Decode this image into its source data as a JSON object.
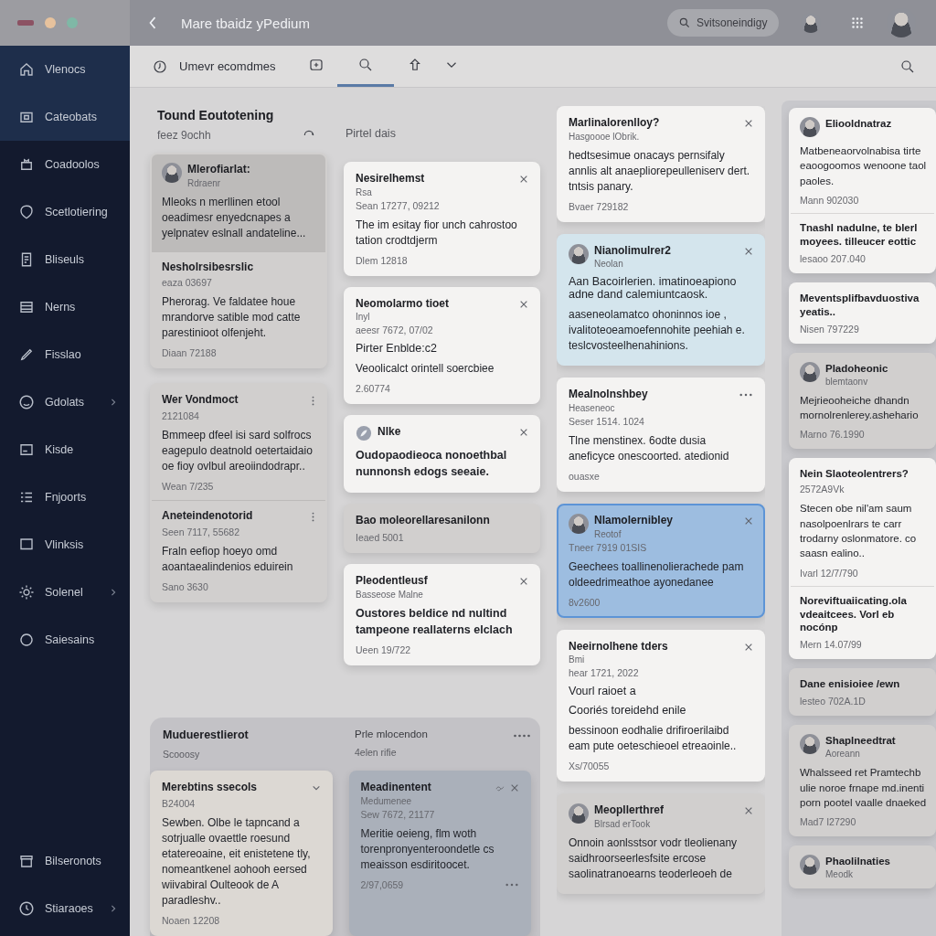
{
  "window": {
    "title": "Mare tbaidz yPedium"
  },
  "top_search": {
    "placeholder": "Svitsoneindigy"
  },
  "sidebar": {
    "items": [
      {
        "label": "Vlenocs",
        "selected": true,
        "expandable": false
      },
      {
        "label": "Cateobats",
        "selected": true,
        "expandable": false
      },
      {
        "label": "Coadoolos",
        "selected": false,
        "expandable": false
      },
      {
        "label": "Scetlotiering",
        "selected": false,
        "expandable": false
      },
      {
        "label": "Bliseuls",
        "selected": false,
        "expandable": false
      },
      {
        "label": "Nerns",
        "selected": false,
        "expandable": false
      },
      {
        "label": "Fisslao",
        "selected": false,
        "expandable": false
      },
      {
        "label": "Gdolats",
        "selected": false,
        "expandable": true
      },
      {
        "label": "Kisde",
        "selected": false,
        "expandable": false
      },
      {
        "label": "Fnjoorts",
        "selected": false,
        "expandable": false
      },
      {
        "label": "Vlinksis",
        "selected": false,
        "expandable": false
      },
      {
        "label": "Solenel",
        "selected": false,
        "expandable": true
      },
      {
        "label": "Saiesains",
        "selected": false,
        "expandable": false
      }
    ],
    "footer_items": [
      {
        "label": "Bilseronots",
        "selected": false,
        "expandable": false
      },
      {
        "label": "Stiaraoes",
        "selected": false,
        "expandable": true
      }
    ]
  },
  "toolbar": {
    "label": "Umevr ecomdmes",
    "tabs": [
      {
        "selected": false
      },
      {
        "selected": true
      },
      {
        "selected": false
      },
      {
        "selected": false
      }
    ]
  },
  "section": {
    "title": "Tound Eoutotening",
    "subtitle": "feez 9ochh",
    "filter": "Pirtel dais"
  },
  "columns": [
    {
      "kind": "stack",
      "cards": [
        {
          "kind": "muted",
          "selected": false,
          "entries": [
            {
              "title": "Mlerofiarlat:",
              "subtitle": "Rdraenr",
              "avatar": true,
              "highlighted": true,
              "body": "Mleoks n merllinen etool oeadimesr enyedcnapes a yelpnatev eslnall andateline..."
            },
            {
              "title": "Nesholrsibesrslic",
              "meta": "eaza 03697",
              "body": "Pherorag. Ve faldatee houe mrandorve satible mod catte parestinioot olfenjeht.",
              "footer": "Diaan 72188"
            }
          ]
        },
        {
          "kind": "muted",
          "selected": false,
          "entries": [
            {
              "title": "Wer Vondmoct",
              "meta": "2121084",
              "options": true,
              "body": "Bmmeep dfeel isi sard solfrocs eagepulo deatnold oetertaidaio oe fioy ovlbul areoiindodrapr..",
              "footer": "Wean 7/235"
            },
            {
              "title": "Aneteindenotorid",
              "meta": "Seen 7117, 55682",
              "options": true,
              "body": "Fraln eefiop hoeyo omd aoantaealindenios eduirein",
              "footer": "Sano 3630"
            }
          ]
        }
      ]
    },
    {
      "kind": "stack",
      "cards": [
        {
          "kind": "plain",
          "selected": false,
          "entries": [
            {
              "title": "Nesirelhemst",
              "subtitle": "Rsa",
              "meta": "Sean 17277, 09212",
              "closable": true,
              "body": "The im esitay fior unch cahrostoo tation crodtdjerm",
              "footer": "Dlem 12818"
            }
          ]
        },
        {
          "kind": "plain",
          "selected": false,
          "entries": [
            {
              "title": "Neomolarmo tioet",
              "subtitle": "Inyl",
              "meta": "aeesr 7672, 07/02",
              "closable": true,
              "lead": [
                "Pirter Enblde:c2"
              ],
              "body": "Veoolicalct orintell soercbiee",
              "footer": "2.60774"
            }
          ]
        },
        {
          "kind": "plain",
          "selected": false,
          "entries": [
            {
              "title": "Nlke",
              "logo": true,
              "closable": true,
              "strong": true,
              "body": "Oudopaodieoca nonoethbal nunnonsh edogs seeaie."
            }
          ]
        },
        {
          "kind": "muted",
          "selected": false,
          "entries": [
            {
              "title": "Bao moleorellaresanilonn",
              "footer": "Ieaed 5001"
            }
          ]
        },
        {
          "kind": "plain",
          "selected": false,
          "entries": [
            {
              "title": "Pleodentleusf",
              "subtitle": "Basseose Malne",
              "closable": true,
              "strong": true,
              "body": "Oustores beldice nd nultind tampeone reallaterns elclach",
              "footer": "Ueen 19/722"
            }
          ]
        }
      ]
    },
    {
      "kind": "stack",
      "cards": [
        {
          "kind": "plain",
          "selected": false,
          "entries": [
            {
              "title": "Marlinalorenlloy?",
              "subtitle": "Hasgoooe lObrik.",
              "closable": true,
              "body": "hedtsesimue onacays pernsifaly annlis alt anaepliorepeulleniserv dert. tntsis panary.",
              "footer": "Bvaer 729182"
            }
          ]
        },
        {
          "kind": "info",
          "selected": false,
          "entries": [
            {
              "title": "Nianolimulrer2",
              "subtitle": "Neolan",
              "avatar": true,
              "closable": true,
              "lead": [
                "Aan Bacoirlerien. imatinoeapiono adne dand calemiuntcaosk."
              ],
              "body": "aaseneolamatco ohoninnos ioe , ivalitoteoeamoefennohite peehiah e. teslcvosteelhenahinions."
            }
          ]
        },
        {
          "kind": "plain",
          "selected": false,
          "entries": [
            {
              "title": "Mealnolnshbey",
              "subtitle": "Heaseneoc",
              "meta": "Seser 1514. 1024",
              "menu": true,
              "body": "Tlne menstinex. 6odte dusia aneficyce onescoorted. atedionid",
              "footer": "ouasxe"
            }
          ]
        },
        {
          "kind": "plain",
          "selected": true,
          "entries": [
            {
              "title": "Nlamolernibley",
              "subtitle": "Reotof",
              "avatar": true,
              "meta": "Tneer 7919 01SIS",
              "closable": true,
              "body": "Geechees toallinenolierachede pam oldeedrimeathoe ayonedanee",
              "footer": "8v2600"
            }
          ]
        },
        {
          "kind": "plain",
          "selected": false,
          "entries": [
            {
              "title": "Neeirnolhene tders",
              "subtitle": "Bmi",
              "meta": "hear 1721, 2022",
              "closable": true,
              "lead": [
                "Vourl raioet a",
                "Cooriés toreidehd enile"
              ],
              "body": "bessinoon eodhalie drifiroerilaibd eam pute oeteschieoel etreaoinle..",
              "footer": "Xs/70055"
            }
          ]
        },
        {
          "kind": "muted",
          "selected": false,
          "entries": [
            {
              "title": "Meopllerthref",
              "subtitle": "Blrsad erTook",
              "avatar": true,
              "closable": true,
              "body": "Onnoin aonlsstsor vodr tleolienany saidhroorseerlesfsite ercose saolinatranoearns teoderleoeh de"
            }
          ]
        }
      ]
    },
    {
      "kind": "rail",
      "cards": [
        {
          "kind": "plain",
          "selected": false,
          "entries": [
            {
              "title": "Eliooldnatraz",
              "avatar": true,
              "body": "Matbeneaorvolnabisa tirte eaoogoomos wenoone taol paoles.",
              "footer": "Mann 902030"
            },
            {
              "title": "Tnashl nadulne, te blerl moyees. tilleucer eottic",
              "footer": "lesaoo 207.040"
            }
          ]
        },
        {
          "kind": "plain",
          "selected": false,
          "entries": [
            {
              "title": "Meventsplifbavduostiva yeatis..",
              "footer": "Nisen 797229"
            }
          ]
        },
        {
          "kind": "muted",
          "selected": false,
          "entries": [
            {
              "title": "Pladoheonic",
              "subtitle": "blemtaonv",
              "avatar": true,
              "body": "Mejrieooheiche dhandn mornolrenlerey.ashehario",
              "footer": "Marno 76.1990"
            }
          ]
        },
        {
          "kind": "plain",
          "selected": false,
          "entries": [
            {
              "title": "Nein Slaoteolentrers?",
              "meta": "2572A9Vk",
              "body": "Stecen obe nil'am saum nasolpoenlrars te carr trodarny oslonmatore. co saasn ealino..",
              "footer": "Ivarl 12/7/790"
            },
            {
              "title": "Noreviftuaiicating.ola vdeaitcees. Vorl eb nocónp",
              "footer": "Mern 14.07/99"
            }
          ]
        },
        {
          "kind": "muted",
          "selected": false,
          "entries": [
            {
              "title": "Dane enisioiee /ewn",
              "footer": "lesteo 702A.1D"
            }
          ]
        },
        {
          "kind": "muted",
          "selected": false,
          "entries": [
            {
              "title": "Shaplneedtrat",
              "subtitle": "Aoreann",
              "avatar": true,
              "body": "Whalsseed ret Pramtechb ulie noroe frnape md.inenti porn pootel vaalle dnaeked",
              "footer": "Mad7 I27290"
            }
          ]
        },
        {
          "kind": "muted",
          "selected": false,
          "entries": [
            {
              "title": "Phaolilnaties",
              "subtitle": "Meodk",
              "avatar": true
            }
          ]
        }
      ]
    },
    {
      "kind": "board",
      "title": "Muduerestlierot",
      "subtitle": "Scooosy",
      "side_title": "Prle mlocendon",
      "side_subtitle": "4elen rifie",
      "cards": [
        {
          "kind": "muted",
          "selected": false,
          "entries": [
            {
              "title": "Merebtins ssecols",
              "meta": "B24004",
              "expandable": true,
              "body": "Sewben. Olbe le tapncand a sotrjualle ovaettle roesund etatereoaine, eit enistetene tly, nomeantkenel aohooh eersed wiivabiral Oulteook de A paradleshv..",
              "footer": "Noaen 12208"
            }
          ]
        },
        {
          "kind": "dim",
          "selected": false,
          "entries": [
            {
              "title": "Meadinentent",
              "subtitle": "Medumenee",
              "meta": "Sew 7672, 21177",
              "linked": true,
              "closable": true,
              "body": "Meritie oeieng, flm woth torenpronyenteroondetle cs meaisson esdiritoocet.",
              "footer": "2/97,0659",
              "footer_menu": true
            }
          ]
        }
      ]
    }
  ]
}
